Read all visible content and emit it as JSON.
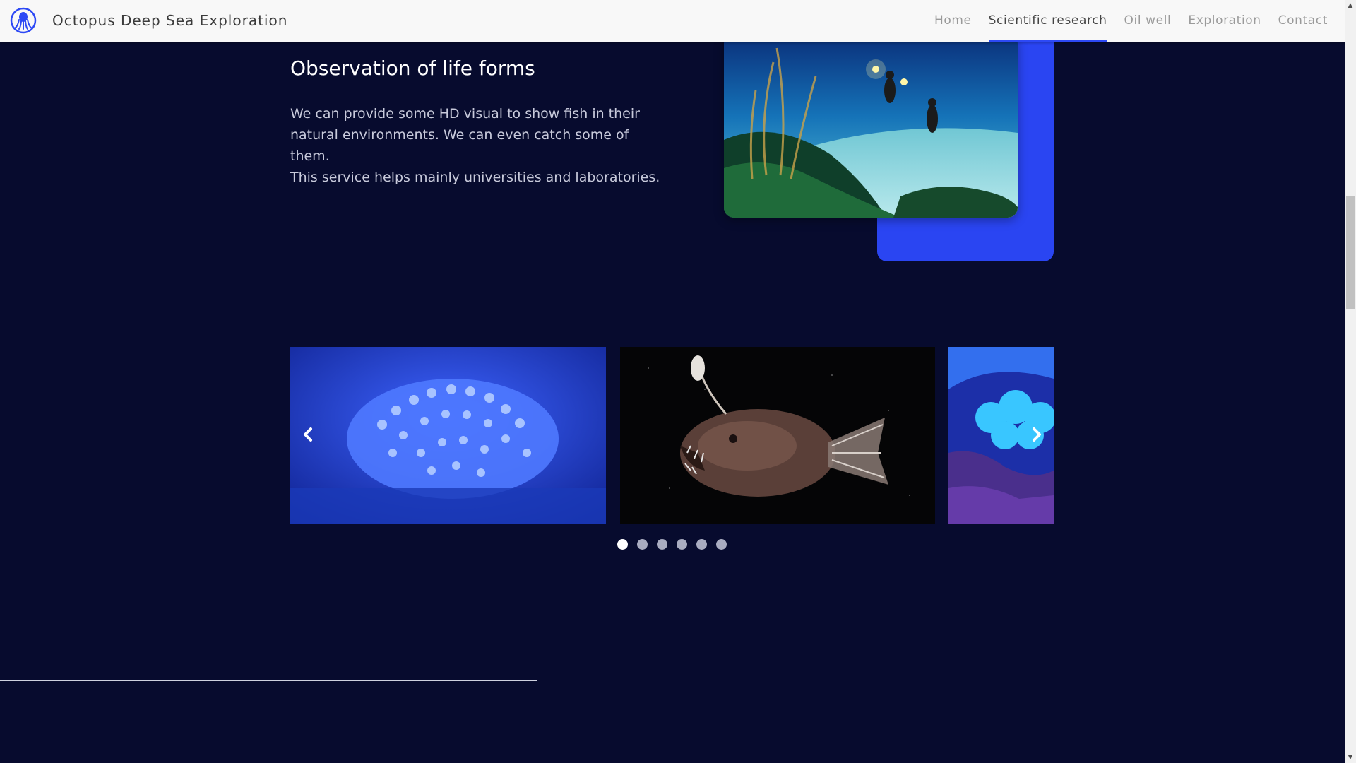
{
  "header": {
    "brand": "Octopus Deep Sea Exploration",
    "logo_icon": "octopus-logo-icon",
    "nav": [
      {
        "label": "Home",
        "active": false
      },
      {
        "label": "Scientific research",
        "active": true
      },
      {
        "label": "Oil well",
        "active": false
      },
      {
        "label": "Exploration",
        "active": false
      },
      {
        "label": "Contact",
        "active": false
      }
    ]
  },
  "observation": {
    "title": "Observation of life forms",
    "paragraph1": "We can provide some HD visual to show fish in their natural environments. We can even catch some of them.",
    "paragraph2": "This service helps mainly universities and laboratories.",
    "image": "divers-coral-reef-photo"
  },
  "carousel": {
    "slides": [
      {
        "image": "blue-coral-anemone-photo"
      },
      {
        "image": "anglerfish-photo"
      },
      {
        "image": "bubble-coral-photo"
      }
    ],
    "prev_icon": "chevron-left-icon",
    "next_icon": "chevron-right-icon",
    "dot_count": 6,
    "active_dot": 1
  },
  "colors": {
    "background": "#070b2e",
    "accent": "#2a45f2",
    "navbar": "#f8f8f8"
  }
}
